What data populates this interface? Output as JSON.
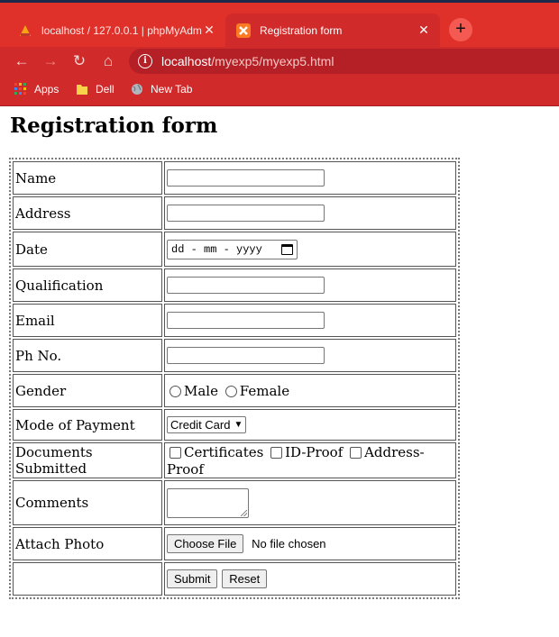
{
  "browser": {
    "tabs": [
      {
        "title": "localhost / 127.0.0.1 | phpMyAdm",
        "active": false
      },
      {
        "title": "Registration form",
        "active": true
      }
    ],
    "new_tab": "+",
    "url_host": "localhost",
    "url_path": "/myexp5/myexp5.html",
    "bookmarks": [
      "Apps",
      "Dell",
      "New Tab"
    ],
    "colors": {
      "chrome": "#e0302a",
      "toolbar": "#d02a2a"
    }
  },
  "page": {
    "heading": "Registration form",
    "labels": {
      "name": "Name",
      "address": "Address",
      "date": "Date",
      "qualification": "Qualification",
      "email": "Email",
      "phone": "Ph No.",
      "gender": "Gender",
      "payment": "Mode of Payment",
      "documents": "Documents Submitted",
      "comments": "Comments",
      "photo": "Attach Photo"
    },
    "date_placeholder": "dd - mm - yyyy",
    "gender_options": {
      "male": "Male",
      "female": "Female"
    },
    "payment_selected": "Credit Card",
    "document_options": {
      "certificates": "Certificates",
      "id_proof": "ID-Proof",
      "address_proof": "Address-Proof"
    },
    "file_button": "Choose File",
    "file_status": "No file chosen",
    "submit_label": "Submit",
    "reset_label": "Reset"
  }
}
